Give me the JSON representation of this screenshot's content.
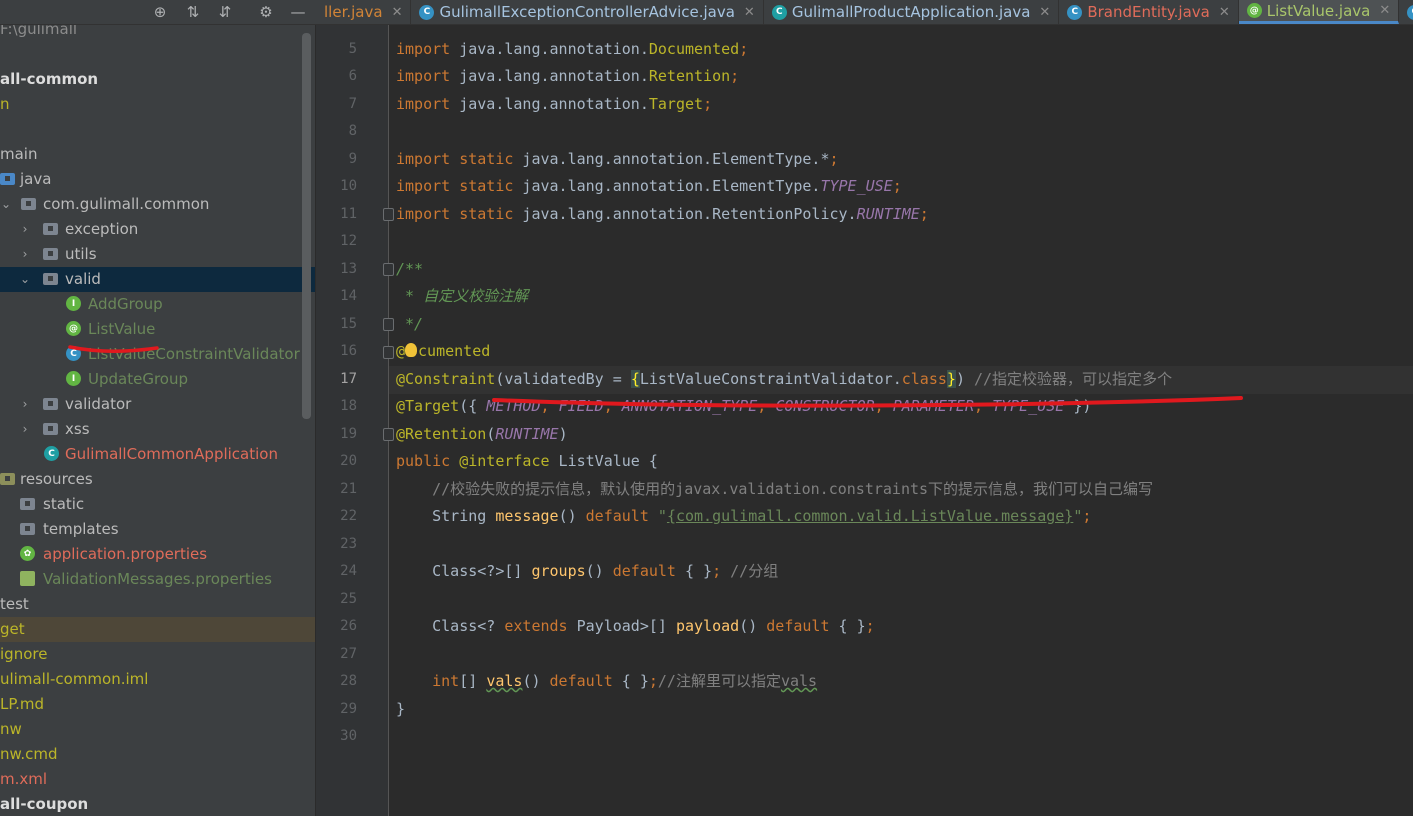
{
  "toolbar": {
    "tabs": [
      {
        "label": "ller.java",
        "icon": "",
        "state": "orange"
      },
      {
        "label": "GulimallExceptionControllerAdvice.java",
        "icon": "C",
        "state": "normal"
      },
      {
        "label": "GulimallProductApplication.java",
        "icon": "C",
        "state": "normal"
      },
      {
        "label": "BrandEntity.java",
        "icon": "C",
        "state": "red"
      },
      {
        "label": "ListValue.java",
        "icon": "@",
        "state": "green"
      }
    ]
  },
  "tree": {
    "rows": [
      {
        "label": "F:\\gulimall",
        "color": "#8c8c8c"
      },
      {
        "label": "all-common",
        "color": "#dddddd"
      },
      {
        "label": "n",
        "color": "#bbb529"
      },
      {
        "label": "",
        "color": "#bbbbbb"
      },
      {
        "label": "main",
        "color": "#bbbbbb"
      },
      {
        "label": "java",
        "color": "#bbbbbb"
      },
      {
        "label": "com.gulimall.common",
        "color": "#bbbbbb"
      },
      {
        "label": "exception",
        "color": "#bbbbbb"
      },
      {
        "label": "utils",
        "color": "#bbbbbb"
      },
      {
        "label": "valid",
        "color": "#bbbbbb"
      },
      {
        "label": "AddGroup",
        "color": "#6a8759"
      },
      {
        "label": "ListValue",
        "color": "#6a8759"
      },
      {
        "label": "ListValueConstraintValidator",
        "color": "#6a8759"
      },
      {
        "label": "UpdateGroup",
        "color": "#6a8759"
      },
      {
        "label": "validator",
        "color": "#bbbbbb"
      },
      {
        "label": "xss",
        "color": "#bbbbbb"
      },
      {
        "label": "GulimallCommonApplication",
        "color": "#e06c5a"
      },
      {
        "label": "resources",
        "color": "#bbbbbb"
      },
      {
        "label": "static",
        "color": "#bbbbbb"
      },
      {
        "label": "templates",
        "color": "#bbbbbb"
      },
      {
        "label": "application.properties",
        "color": "#e06c5a"
      },
      {
        "label": "ValidationMessages.properties",
        "color": "#6a8759"
      },
      {
        "label": "test",
        "color": "#bbbbbb"
      },
      {
        "label": "get",
        "color": "#bbb529"
      },
      {
        "label": "ignore",
        "color": "#bbb529"
      },
      {
        "label": "ulimall-common.iml",
        "color": "#bbb529"
      },
      {
        "label": "LP.md",
        "color": "#bbb529"
      },
      {
        "label": "nw",
        "color": "#bbb529"
      },
      {
        "label": "nw.cmd",
        "color": "#bbb529"
      },
      {
        "label": "m.xml",
        "color": "#e06c5a"
      },
      {
        "label": "all-coupon",
        "color": "#dddddd"
      }
    ]
  },
  "editor": {
    "line_numbers": [
      "5",
      "6",
      "7",
      "8",
      "9",
      "10",
      "11",
      "12",
      "13",
      "14",
      "15",
      "16",
      "17",
      "18",
      "19",
      "20",
      "21",
      "22",
      "23",
      "24",
      "25",
      "26",
      "27",
      "28",
      "29",
      "30"
    ],
    "current_line": "17",
    "code": {
      "l5": [
        "import",
        " java.lang.annotation.",
        "Documented",
        ";"
      ],
      "l6": [
        "import",
        " java.lang.annotation.",
        "Retention",
        ";"
      ],
      "l7": [
        "import",
        " java.lang.annotation.",
        "Target",
        ";"
      ],
      "l9": [
        "import static",
        " java.lang.annotation.ElementType.*",
        ";"
      ],
      "l10": [
        "import static",
        " java.lang.annotation.ElementType.",
        "TYPE_USE",
        ";"
      ],
      "l11": [
        "import static",
        " java.lang.annotation.RetentionPolicy.",
        "RUNTIME",
        ";"
      ],
      "l13": "/**",
      "l14": " * 自定义校验注解",
      "l15": " */",
      "l16": [
        "@",
        "cumented"
      ],
      "l17": [
        "@Constraint",
        "(validatedBy = ",
        "{",
        "ListValueConstraintValidator.",
        "class",
        "}",
        ") ",
        "//指定校验器，可以指定多个"
      ],
      "l18": [
        "@Target",
        "({ ",
        "METHOD",
        ", ",
        "FIELD",
        ", ",
        "ANNOTATION_TYPE",
        ", ",
        "CONSTRUCTOR",
        ", ",
        "PARAMETER",
        ", ",
        "TYPE_USE",
        " })"
      ],
      "l19": [
        "@Retention",
        "(",
        "RUNTIME",
        ")"
      ],
      "l20": [
        "public ",
        "@interface",
        " ListValue {"
      ],
      "l21": "    //校验失败的提示信息，默认使用的javax.validation.constraints下的提示信息，我们可以自己编写",
      "l22": [
        "    String ",
        "message",
        "() ",
        "default",
        " \"",
        "{com.gulimall.common.valid.ListValue.message}",
        "\"",
        ";"
      ],
      "l24": [
        "    Class<?>[] ",
        "groups",
        "() ",
        "default",
        " { }",
        "; ",
        "//分组"
      ],
      "l26": [
        "    Class<? ",
        "extends",
        " Payload>[] ",
        "payload",
        "() ",
        "default",
        " { }",
        ";"
      ],
      "l28": [
        "    ",
        "int",
        "[] ",
        "vals",
        "() ",
        "default",
        " { }",
        ";",
        "//注解里可以指定",
        "vals"
      ],
      "l29": "}"
    }
  },
  "colors": {
    "keyword": "#cc7832",
    "annotation": "#bbb529",
    "string": "#6a8759",
    "doc_comment": "#629755",
    "comment": "#808080",
    "static_field": "#9876aa",
    "method": "#ffc66d",
    "red_markup": "#e0191e",
    "selection": "#0d293e"
  }
}
